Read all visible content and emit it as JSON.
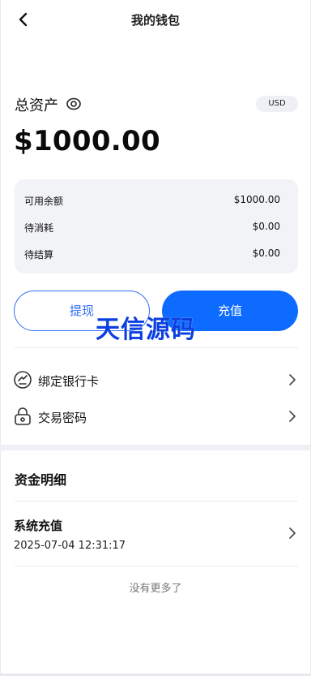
{
  "navbar": {
    "title": "我的钱包"
  },
  "assets": {
    "label": "总资产",
    "currency": "USD",
    "balance": "$1000.00"
  },
  "summary": {
    "rows": [
      {
        "label": "可用余额",
        "value": "$1000.00"
      },
      {
        "label": "待消耗",
        "value": "$0.00"
      },
      {
        "label": "待结算",
        "value": "$0.00"
      }
    ]
  },
  "actions": {
    "withdraw_label": "提现",
    "recharge_label": "充值"
  },
  "watermark": "天信源码",
  "menu": [
    {
      "label": "绑定银行卡",
      "icon": "bank-card-icon"
    },
    {
      "label": "交易密码",
      "icon": "lock-icon"
    }
  ],
  "details": {
    "title": "资金明细",
    "records": [
      {
        "title": "系统充值",
        "time": "2025-07-04 12:31:17"
      }
    ],
    "no_more": "没有更多了"
  },
  "colors": {
    "primary": "#0e6bff",
    "outline": "#2f6ff5",
    "card_bg": "#f2f3f6",
    "watermark": "#0b3fe0"
  }
}
